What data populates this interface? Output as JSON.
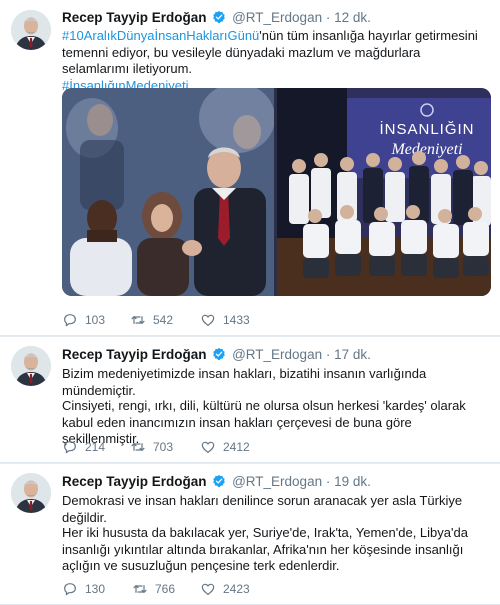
{
  "author": {
    "name": "Recep Tayyip Erdoğan",
    "handle": "@RT_Erdogan"
  },
  "colors": {
    "link": "#1b95e0",
    "verified": "#1da1f2",
    "muted": "#657786"
  },
  "tweets": [
    {
      "dot": "·",
      "time": "12 dk.",
      "hashtag1": "#10AralıkDünyaİnsanHaklarıGünü",
      "text_rest": "'nün tüm insanlığa hayırlar getirmesini temenni ediyor, bu vesileyle dünyadaki mazlum ve mağdurlara selamlarımı iletiyorum.",
      "hashtag2": "#İnsanlığınMedeniyeti",
      "media": {
        "banner_line1": "İNSANLIĞIN",
        "banner_line2": "Medeniyeti"
      },
      "replies": "103",
      "retweets": "542",
      "likes": "1433"
    },
    {
      "dot": "·",
      "time": "17 dk.",
      "paragraph1": "Bizim medeniyetimizde insan hakları, bizatihi insanın varlığında mündemiçtir.",
      "paragraph2": "Cinsiyeti, rengi, ırkı, dili, kültürü ne olursa olsun herkesi 'kardeş' olarak kabul eden inancımızın insan hakları çerçevesi de buna göre şekillenmiştir.",
      "replies": "214",
      "retweets": "703",
      "likes": "2412"
    },
    {
      "dot": "·",
      "time": "19 dk.",
      "paragraph1": "Demokrasi ve insan hakları denilince sorun aranacak yer asla Türkiye değildir.",
      "paragraph2": "Her iki hususta da bakılacak yer, Suriye'de, Irak'ta, Yemen'de, Libya'da insanlığı yıkıntılar altında bırakanlar, Afrika'nın her köşesinde insanlığı açlığın ve susuzluğun pençesine terk edenlerdir.",
      "replies": "130",
      "retweets": "766",
      "likes": "2423"
    }
  ]
}
